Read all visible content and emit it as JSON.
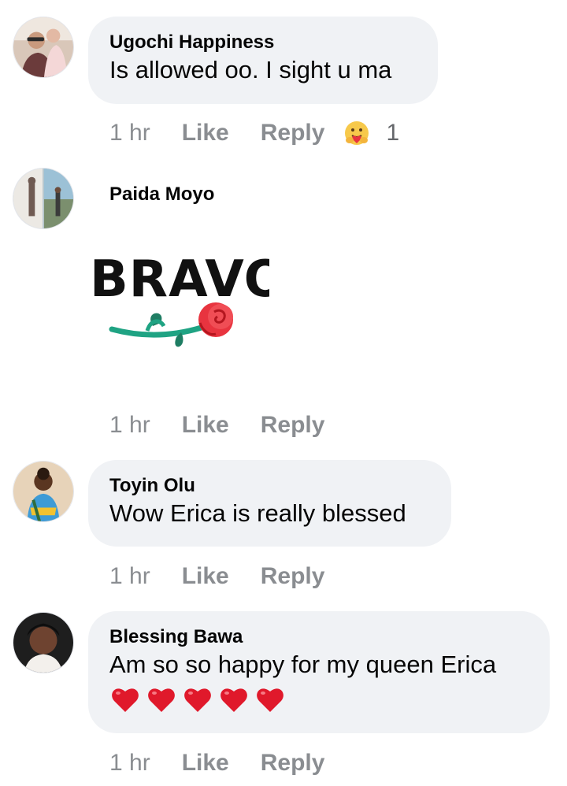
{
  "comments": [
    {
      "author": "Ugochi Happiness",
      "text": "Is allowed oo. I sight u ma",
      "time": "1 hr",
      "like_label": "Like",
      "reply_label": "Reply",
      "reaction_icon": "care-reaction-icon",
      "reaction_count": "1"
    },
    {
      "author": "Paida Moyo",
      "sticker_text": "BRAVO!",
      "sticker_icon": "rose-sticker",
      "time": "1 hr",
      "like_label": "Like",
      "reply_label": "Reply"
    },
    {
      "author": "Toyin Olu",
      "text": "Wow Erica is really blessed",
      "time": "1 hr",
      "like_label": "Like",
      "reply_label": "Reply"
    },
    {
      "author": "Blessing Bawa",
      "text": "Am so so happy for my queen Erica",
      "emoji_icon": "red-heart-icon",
      "emoji_count": 5,
      "time": "1 hr",
      "like_label": "Like",
      "reply_label": "Reply"
    }
  ],
  "colors": {
    "bubble": "#f0f2f5",
    "meta_text": "#8a8d91",
    "heart": "#e0192b",
    "rose": "#e8343f",
    "stem": "#1fa383"
  }
}
